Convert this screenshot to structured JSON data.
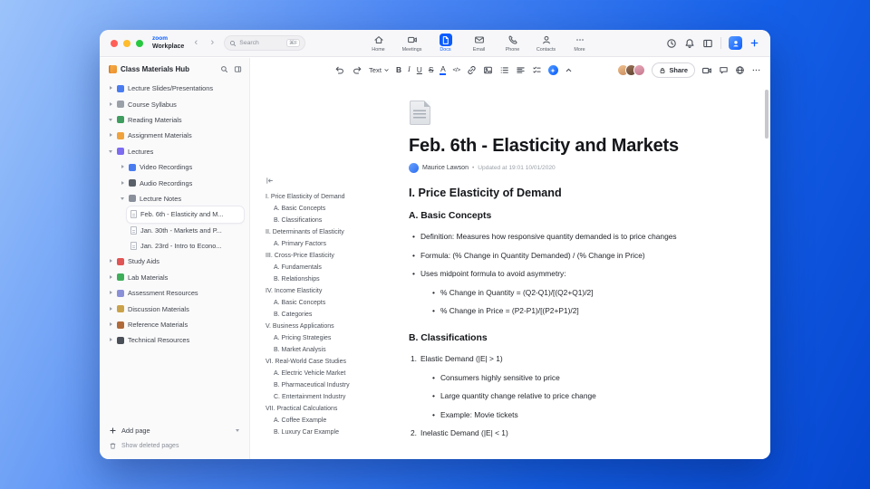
{
  "colors": {
    "accent": "#0b5cff",
    "stage_gradient_start": "#9cc3fa",
    "stage_gradient_end": "#0646cf",
    "sidebar_bg": "#fafafb",
    "selection_bg": "#ffffff"
  },
  "titlebar": {
    "brand_top": "zoom",
    "brand_bottom": "Workplace",
    "back": "‹",
    "forward": "›",
    "search_placeholder": "Search",
    "search_shortcut": "⌘F",
    "tabs": [
      {
        "label": "Home"
      },
      {
        "label": "Meetings"
      },
      {
        "label": "Docs"
      },
      {
        "label": "Email"
      },
      {
        "label": "Phone"
      },
      {
        "label": "Contacts"
      },
      {
        "label": "More"
      }
    ]
  },
  "sidebar": {
    "title": "Class Materials Hub",
    "items": [
      {
        "label": "Lecture Slides/Presentations",
        "level": 0,
        "expanded": false,
        "icon_style": "background:#4a7cf0"
      },
      {
        "label": "Course Syllabus",
        "level": 0,
        "expanded": false,
        "icon_style": "background:#9aa0a8"
      },
      {
        "label": "Reading Materials",
        "level": 0,
        "expanded": true,
        "icon_style": "background:#3f9d5f"
      },
      {
        "label": "Assignment Materials",
        "level": 0,
        "expanded": false,
        "icon_style": "background:#f0a23c"
      },
      {
        "label": "Lectures",
        "level": 0,
        "expanded": true,
        "icon_style": "background:#7d6bf0"
      },
      {
        "label": "Video Recordings",
        "level": 1,
        "expanded": false,
        "icon_style": "background:#4a7cf0"
      },
      {
        "label": "Audio Recordings",
        "level": 1,
        "expanded": false,
        "icon_style": "background:#5a6068"
      },
      {
        "label": "Lecture Notes",
        "level": 1,
        "expanded": true,
        "icon_style": "background:#8a909a"
      },
      {
        "label": "Feb. 6th - Elasticity and M...",
        "level": 2,
        "doc": true,
        "selected": true
      },
      {
        "label": "Jan. 30th - Markets and P...",
        "level": 2,
        "doc": true,
        "selected": false
      },
      {
        "label": "Jan. 23rd - Intro to Econo...",
        "level": 2,
        "doc": true,
        "selected": false
      },
      {
        "label": "Study Aids",
        "level": 0,
        "expanded": false,
        "icon_style": "background:#e05555"
      },
      {
        "label": "Lab Materials",
        "level": 0,
        "expanded": false,
        "icon_style": "background:#3fae5a"
      },
      {
        "label": "Assessment Resources",
        "level": 0,
        "expanded": false,
        "icon_style": "background:#8a90d8"
      },
      {
        "label": "Discussion Materials",
        "level": 0,
        "expanded": false,
        "icon_style": "background:#caa24a"
      },
      {
        "label": "Reference Materials",
        "level": 0,
        "expanded": false,
        "icon_style": "background:#b06a3a"
      },
      {
        "label": "Technical Resources",
        "level": 0,
        "expanded": false,
        "icon_style": "background:#4a4f58"
      }
    ],
    "add_page": "Add page",
    "show_deleted": "Show deleted pages"
  },
  "toolbar": {
    "text_style": "Text",
    "bold": "B",
    "italic": "I",
    "underline": "U",
    "strikethrough": "S",
    "text_color": "A",
    "code": "</>",
    "share": "Share"
  },
  "outline": {
    "items": [
      {
        "t": "I. Price Elasticity of Demand",
        "lvl": 0
      },
      {
        "t": "A. Basic Concepts",
        "lvl": 1
      },
      {
        "t": "B. Classifications",
        "lvl": 1
      },
      {
        "t": "II. Determinants of Elasticity",
        "lvl": 0
      },
      {
        "t": "A. Primary Factors",
        "lvl": 1
      },
      {
        "t": "III. Cross-Price Elasticity",
        "lvl": 0
      },
      {
        "t": "A. Fundamentals",
        "lvl": 1
      },
      {
        "t": "B. Relationships",
        "lvl": 1
      },
      {
        "t": "IV. Income Elasticity",
        "lvl": 0
      },
      {
        "t": "A. Basic Concepts",
        "lvl": 1
      },
      {
        "t": "B. Categories",
        "lvl": 1
      },
      {
        "t": "V. Business Applications",
        "lvl": 0
      },
      {
        "t": "A. Pricing Strategies",
        "lvl": 1
      },
      {
        "t": "B. Market Analysis",
        "lvl": 1
      },
      {
        "t": "VI. Real-World Case Studies",
        "lvl": 0
      },
      {
        "t": "A. Electric Vehicle Market",
        "lvl": 1
      },
      {
        "t": "B. Pharmaceutical Industry",
        "lvl": 1
      },
      {
        "t": "C. Entertainment Industry",
        "lvl": 1
      },
      {
        "t": "VII. Practical Calculations",
        "lvl": 0
      },
      {
        "t": "A. Coffee Example",
        "lvl": 1
      },
      {
        "t": "B. Luxury Car Example",
        "lvl": 1
      }
    ]
  },
  "doc": {
    "title": "Feb. 6th - Elasticity and Markets",
    "author": "Maurice Lawson",
    "meta_sep": "•",
    "updated": "Updated at 19:01 10/01/2020",
    "h1": "I. Price Elasticity of Demand",
    "h2a": "A. Basic Concepts",
    "bullets": [
      "Definition: Measures how responsive quantity demanded is to price changes",
      "Formula: (% Change in Quantity Demanded) / (% Change in Price)",
      "Uses midpoint formula to avoid asymmetry:"
    ],
    "sub_bullets": [
      "% Change in Quantity = (Q2-Q1)/[(Q2+Q1)/2]",
      "% Change in Price = (P2-P1)/[(P2+P1)/2]"
    ],
    "h2b": "B. Classifications",
    "list": [
      {
        "num": "1.",
        "text": "Elastic Demand (|E| > 1)"
      },
      {
        "num": "2.",
        "text": "Inelastic Demand (|E| < 1)"
      }
    ],
    "list1_subs": [
      "Consumers highly sensitive to price",
      "Large quantity change relative to price change",
      "Example: Movie tickets"
    ]
  }
}
